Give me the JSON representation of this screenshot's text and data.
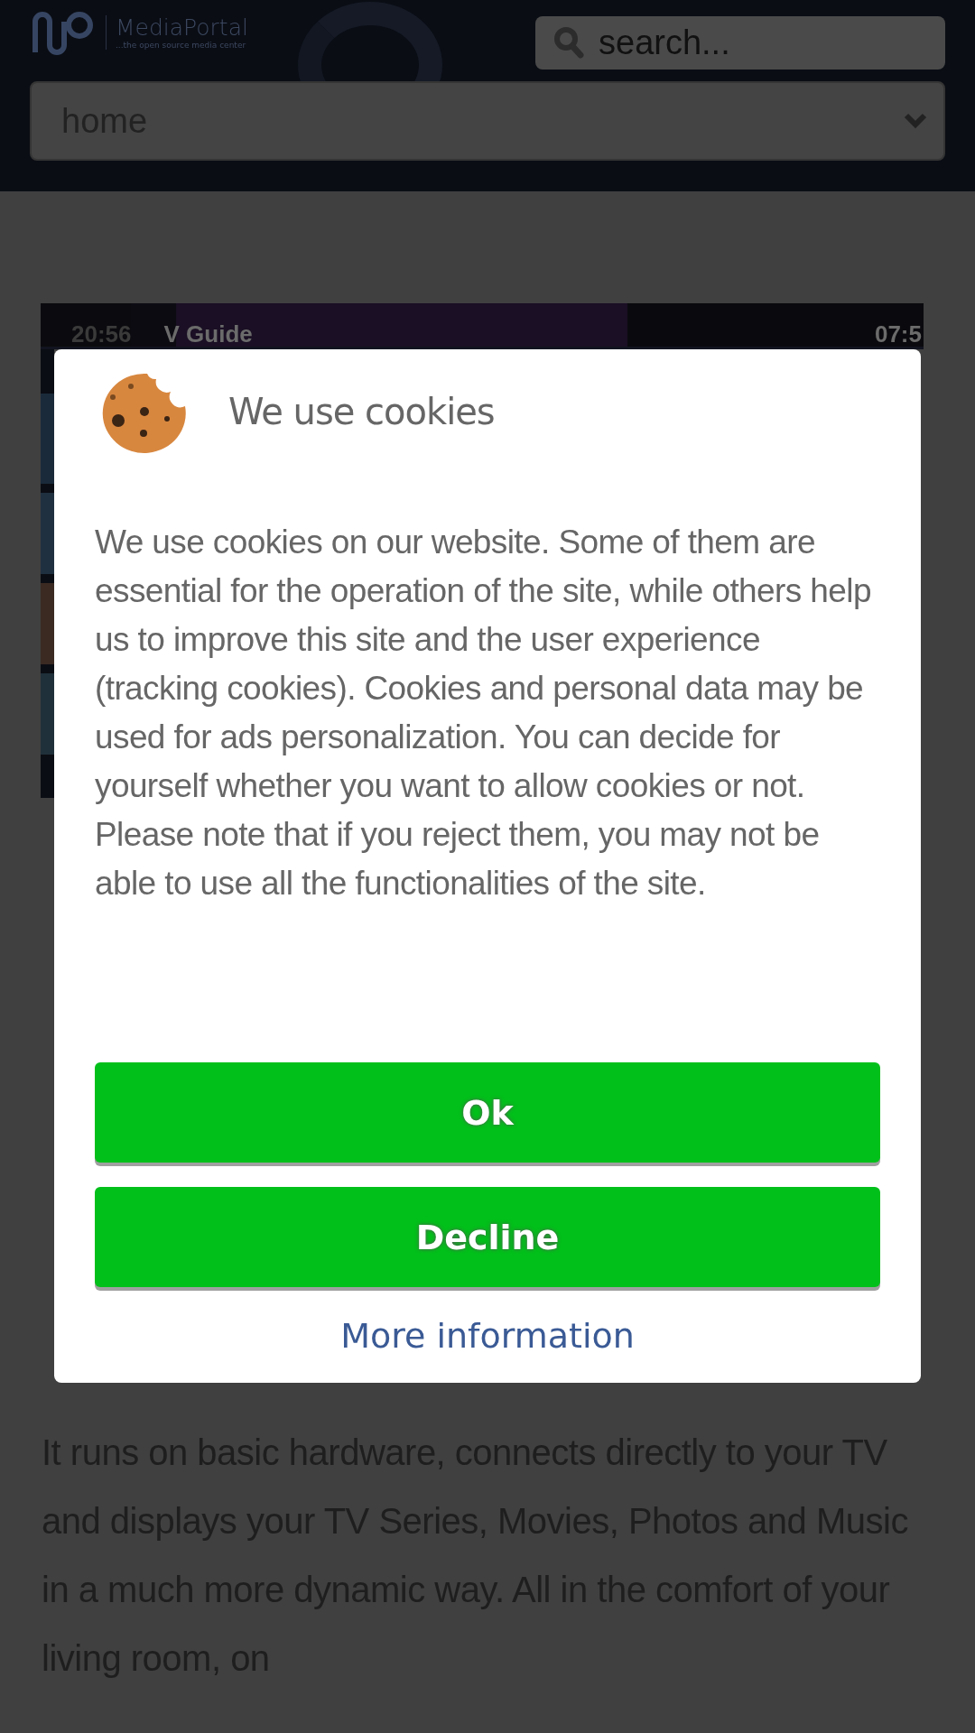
{
  "header": {
    "logo_name": "MediaPortal",
    "logo_tagline": "...the open source media center",
    "search": {
      "placeholder": "search..."
    },
    "nav_select": {
      "value": "home"
    }
  },
  "screenshot": {
    "kind": "picture",
    "top_bar": [
      "20:56",
      "V Guide",
      "07:5"
    ]
  },
  "article": {
    "paragraph": "It runs on basic hardware, connects directly to your TV and displays your TV Series, Movies, Photos and Music in a much more dynamic way. All in the comfort of your living room, on"
  },
  "cookie_dialog": {
    "title": "We use cookies",
    "message": "We use cookies on our website. Some of them are essential for the operation of the site, while others help us to improve this site and the user experience (tracking cookies). Cookies and personal data may be used for ads personalization. You can decide for yourself whether you want to allow cookies or not. Please note that if you reject them, you may not be able to use all the functionalities of the site.",
    "buttons": [
      "Ok",
      "Decline"
    ],
    "link": "More information"
  }
}
